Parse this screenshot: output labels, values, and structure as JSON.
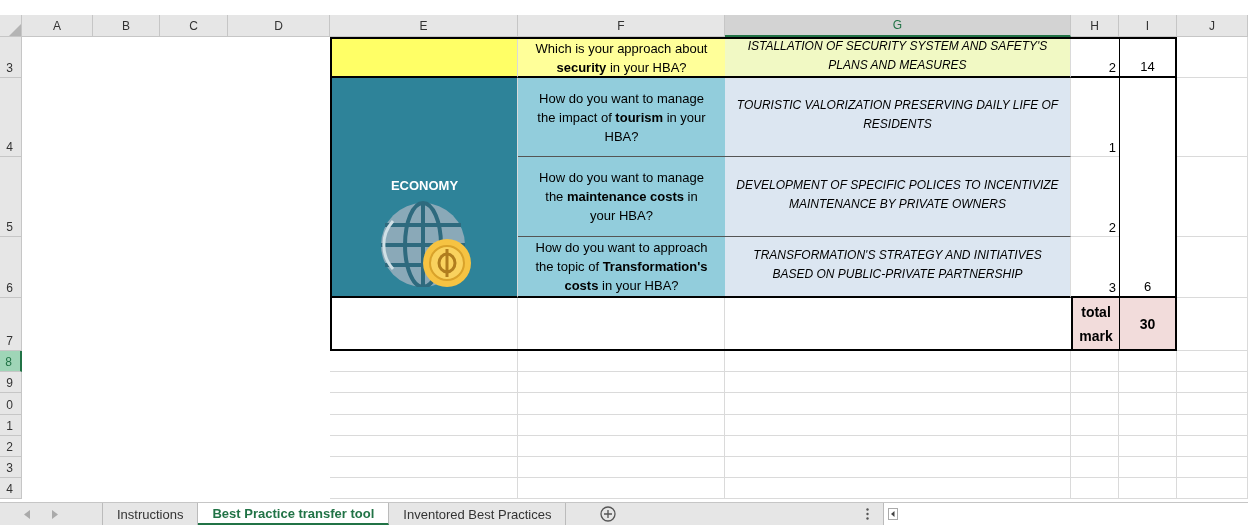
{
  "columns": [
    {
      "label": "A",
      "selected": false
    },
    {
      "label": "B",
      "selected": false
    },
    {
      "label": "C",
      "selected": false
    },
    {
      "label": "D",
      "selected": false
    },
    {
      "label": "E",
      "selected": false
    },
    {
      "label": "F",
      "selected": false
    },
    {
      "label": "G",
      "selected": true
    },
    {
      "label": "H",
      "selected": false
    },
    {
      "label": "I",
      "selected": false
    },
    {
      "label": "J",
      "selected": false
    }
  ],
  "rows": [
    {
      "label": "3",
      "selected": false
    },
    {
      "label": "4",
      "selected": false
    },
    {
      "label": "5",
      "selected": false
    },
    {
      "label": "6",
      "selected": false
    },
    {
      "label": "7",
      "selected": false
    },
    {
      "label": "8",
      "selected": true
    },
    {
      "label": "9",
      "selected": false
    },
    {
      "label": "0",
      "selected": false
    },
    {
      "label": "1",
      "selected": false
    },
    {
      "label": "2",
      "selected": false
    },
    {
      "label": "3",
      "selected": false
    },
    {
      "label": "4",
      "selected": false
    }
  ],
  "blocks": [
    {
      "kind": "plain",
      "subtotal": "14",
      "questions": [
        {
          "question": "Which is your approach about **security** in your HBA?",
          "answer": "ISTALLATION OF SECURITY SYSTEM AND SAFETY'S PLANS AND MEASURES",
          "score": "2"
        }
      ]
    },
    {
      "kind": "themed",
      "title": "ECONOMY",
      "subtotal": "6",
      "questions": [
        {
          "question": "How do you want to manage the impact of **tourism** in your HBA?",
          "answer": "TOURISTIC VALORIZATION PRESERVING DAILY LIFE OF RESIDENTS",
          "score": "1"
        },
        {
          "question": "How do you want to manage the **maintenance costs** in your HBA?",
          "answer": "DEVELOPMENT OF SPECIFIC POLICES TO INCENTIVIZE MAINTENANCE BY PRIVATE OWNERS",
          "score": "2"
        },
        {
          "question": "How do you want to approach the topic of **Transformation's costs** in your HBA?",
          "answer": "TRANSFORMATION'S STRATEGY AND INITIATIVES BASED ON PUBLIC-PRIVATE PARTNERSHIP",
          "score": "3"
        }
      ]
    }
  ],
  "total": {
    "label": "total mark",
    "value": "30"
  },
  "sheet_tabs": [
    {
      "label": "Instructions",
      "selected": false
    },
    {
      "label": "Best Practice transfer tool",
      "selected": true
    },
    {
      "label": "Inventored Best Practices",
      "selected": false
    }
  ]
}
